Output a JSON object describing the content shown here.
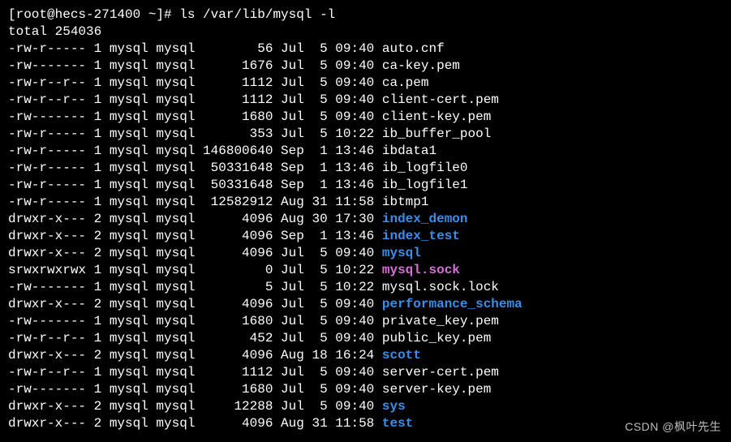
{
  "prompt": "[root@hecs-271400 ~]# ls /var/lib/mysql -l",
  "total": "total 254036",
  "rows": [
    {
      "perm": "-rw-r-----",
      "ln": "1",
      "u": "mysql",
      "g": "mysql",
      "size": "56",
      "mon": "Jul",
      "day": "5",
      "time": "09:40",
      "name": "auto.cnf",
      "t": "file"
    },
    {
      "perm": "-rw-------",
      "ln": "1",
      "u": "mysql",
      "g": "mysql",
      "size": "1676",
      "mon": "Jul",
      "day": "5",
      "time": "09:40",
      "name": "ca-key.pem",
      "t": "file"
    },
    {
      "perm": "-rw-r--r--",
      "ln": "1",
      "u": "mysql",
      "g": "mysql",
      "size": "1112",
      "mon": "Jul",
      "day": "5",
      "time": "09:40",
      "name": "ca.pem",
      "t": "file"
    },
    {
      "perm": "-rw-r--r--",
      "ln": "1",
      "u": "mysql",
      "g": "mysql",
      "size": "1112",
      "mon": "Jul",
      "day": "5",
      "time": "09:40",
      "name": "client-cert.pem",
      "t": "file"
    },
    {
      "perm": "-rw-------",
      "ln": "1",
      "u": "mysql",
      "g": "mysql",
      "size": "1680",
      "mon": "Jul",
      "day": "5",
      "time": "09:40",
      "name": "client-key.pem",
      "t": "file"
    },
    {
      "perm": "-rw-r-----",
      "ln": "1",
      "u": "mysql",
      "g": "mysql",
      "size": "353",
      "mon": "Jul",
      "day": "5",
      "time": "10:22",
      "name": "ib_buffer_pool",
      "t": "file"
    },
    {
      "perm": "-rw-r-----",
      "ln": "1",
      "u": "mysql",
      "g": "mysql",
      "size": "146800640",
      "mon": "Sep",
      "day": "1",
      "time": "13:46",
      "name": "ibdata1",
      "t": "file"
    },
    {
      "perm": "-rw-r-----",
      "ln": "1",
      "u": "mysql",
      "g": "mysql",
      "size": "50331648",
      "mon": "Sep",
      "day": "1",
      "time": "13:46",
      "name": "ib_logfile0",
      "t": "file"
    },
    {
      "perm": "-rw-r-----",
      "ln": "1",
      "u": "mysql",
      "g": "mysql",
      "size": "50331648",
      "mon": "Sep",
      "day": "1",
      "time": "13:46",
      "name": "ib_logfile1",
      "t": "file"
    },
    {
      "perm": "-rw-r-----",
      "ln": "1",
      "u": "mysql",
      "g": "mysql",
      "size": "12582912",
      "mon": "Aug",
      "day": "31",
      "time": "11:58",
      "name": "ibtmp1",
      "t": "file"
    },
    {
      "perm": "drwxr-x---",
      "ln": "2",
      "u": "mysql",
      "g": "mysql",
      "size": "4096",
      "mon": "Aug",
      "day": "30",
      "time": "17:30",
      "name": "index_demon",
      "t": "dir"
    },
    {
      "perm": "drwxr-x---",
      "ln": "2",
      "u": "mysql",
      "g": "mysql",
      "size": "4096",
      "mon": "Sep",
      "day": "1",
      "time": "13:46",
      "name": "index_test",
      "t": "dir"
    },
    {
      "perm": "drwxr-x---",
      "ln": "2",
      "u": "mysql",
      "g": "mysql",
      "size": "4096",
      "mon": "Jul",
      "day": "5",
      "time": "09:40",
      "name": "mysql",
      "t": "dir"
    },
    {
      "perm": "srwxrwxrwx",
      "ln": "1",
      "u": "mysql",
      "g": "mysql",
      "size": "0",
      "mon": "Jul",
      "day": "5",
      "time": "10:22",
      "name": "mysql.sock",
      "t": "link"
    },
    {
      "perm": "-rw-------",
      "ln": "1",
      "u": "mysql",
      "g": "mysql",
      "size": "5",
      "mon": "Jul",
      "day": "5",
      "time": "10:22",
      "name": "mysql.sock.lock",
      "t": "file"
    },
    {
      "perm": "drwxr-x---",
      "ln": "2",
      "u": "mysql",
      "g": "mysql",
      "size": "4096",
      "mon": "Jul",
      "day": "5",
      "time": "09:40",
      "name": "performance_schema",
      "t": "dir"
    },
    {
      "perm": "-rw-------",
      "ln": "1",
      "u": "mysql",
      "g": "mysql",
      "size": "1680",
      "mon": "Jul",
      "day": "5",
      "time": "09:40",
      "name": "private_key.pem",
      "t": "file"
    },
    {
      "perm": "-rw-r--r--",
      "ln": "1",
      "u": "mysql",
      "g": "mysql",
      "size": "452",
      "mon": "Jul",
      "day": "5",
      "time": "09:40",
      "name": "public_key.pem",
      "t": "file"
    },
    {
      "perm": "drwxr-x---",
      "ln": "2",
      "u": "mysql",
      "g": "mysql",
      "size": "4096",
      "mon": "Aug",
      "day": "18",
      "time": "16:24",
      "name": "scott",
      "t": "dir"
    },
    {
      "perm": "-rw-r--r--",
      "ln": "1",
      "u": "mysql",
      "g": "mysql",
      "size": "1112",
      "mon": "Jul",
      "day": "5",
      "time": "09:40",
      "name": "server-cert.pem",
      "t": "file"
    },
    {
      "perm": "-rw-------",
      "ln": "1",
      "u": "mysql",
      "g": "mysql",
      "size": "1680",
      "mon": "Jul",
      "day": "5",
      "time": "09:40",
      "name": "server-key.pem",
      "t": "file"
    },
    {
      "perm": "drwxr-x---",
      "ln": "2",
      "u": "mysql",
      "g": "mysql",
      "size": "12288",
      "mon": "Jul",
      "day": "5",
      "time": "09:40",
      "name": "sys",
      "t": "dir"
    },
    {
      "perm": "drwxr-x---",
      "ln": "2",
      "u": "mysql",
      "g": "mysql",
      "size": "4096",
      "mon": "Aug",
      "day": "31",
      "time": "11:58",
      "name": "test",
      "t": "dir"
    }
  ],
  "watermark": "CSDN @枫叶先生"
}
